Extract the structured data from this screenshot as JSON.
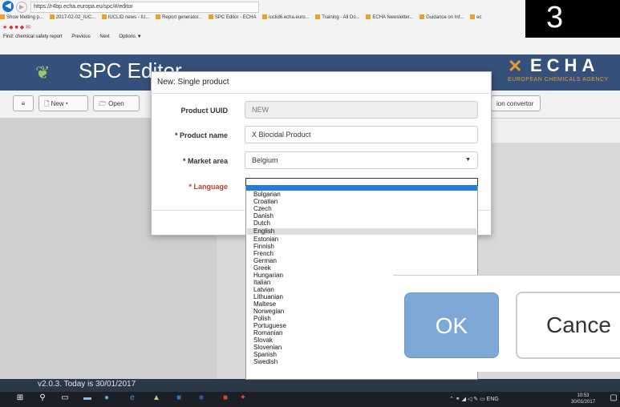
{
  "browser": {
    "url": "https://r4bp.echa.europa.eu/spc/#/editor",
    "favorites": [
      "Show Melting p...",
      "2017-02-02_IUC...",
      "IUCLID news - IU...",
      "Report generator...",
      "SPC Editor - ECHA",
      "iuclid6.echa.euro...",
      "Training - All Do...",
      "ECHA Newsletter...",
      "Guidance on Inf...",
      "ec"
    ],
    "find_label": "Find: chemical safety report",
    "find_prev": "Previous",
    "find_next": "Next",
    "find_options": "Options ▼"
  },
  "app": {
    "title": "SPC Editor",
    "echa_name": "ECHA",
    "echa_subtitle": "EUROPEAN CHEMICALS AGENCY",
    "toolbar": {
      "menu_label": "≡",
      "new_label": "New ▾",
      "open_label": "Open",
      "convertor_label": "ion convertor"
    },
    "version_text": "v2.0.3. Today is 30/01/2017"
  },
  "modal": {
    "title": "New: Single product",
    "fields": {
      "uuid_label": "Product UUID",
      "uuid_value": "NEW",
      "name_label": "* Product name",
      "name_value": "X Biocidal Product",
      "market_label": "* Market area",
      "market_value": "Belgium",
      "language_label": "* Language"
    }
  },
  "language_options": [
    "Bulgarian",
    "Croatian",
    "Czech",
    "Danish",
    "Dutch",
    "English",
    "Estonian",
    "Finnish",
    "French",
    "German",
    "Greek",
    "Hungarian",
    "Italian",
    "Latvian",
    "Lithuanian",
    "Maltese",
    "Norwegian",
    "Polish",
    "Portuguese",
    "Romanian",
    "Slovak",
    "Slovenian",
    "Spanish",
    "Swedish"
  ],
  "language_selected": "English",
  "overlay": {
    "ok_label": "OK",
    "cancel_label": "Cance",
    "step_number": "3"
  },
  "taskbar": {
    "lang": "ENG",
    "time": "10:53",
    "date": "30/01/2017"
  },
  "colors": {
    "header": "#35507a",
    "echa_accent": "#e89a2d",
    "ok_button": "#7ea9d6",
    "required_red": "#c0392b"
  }
}
